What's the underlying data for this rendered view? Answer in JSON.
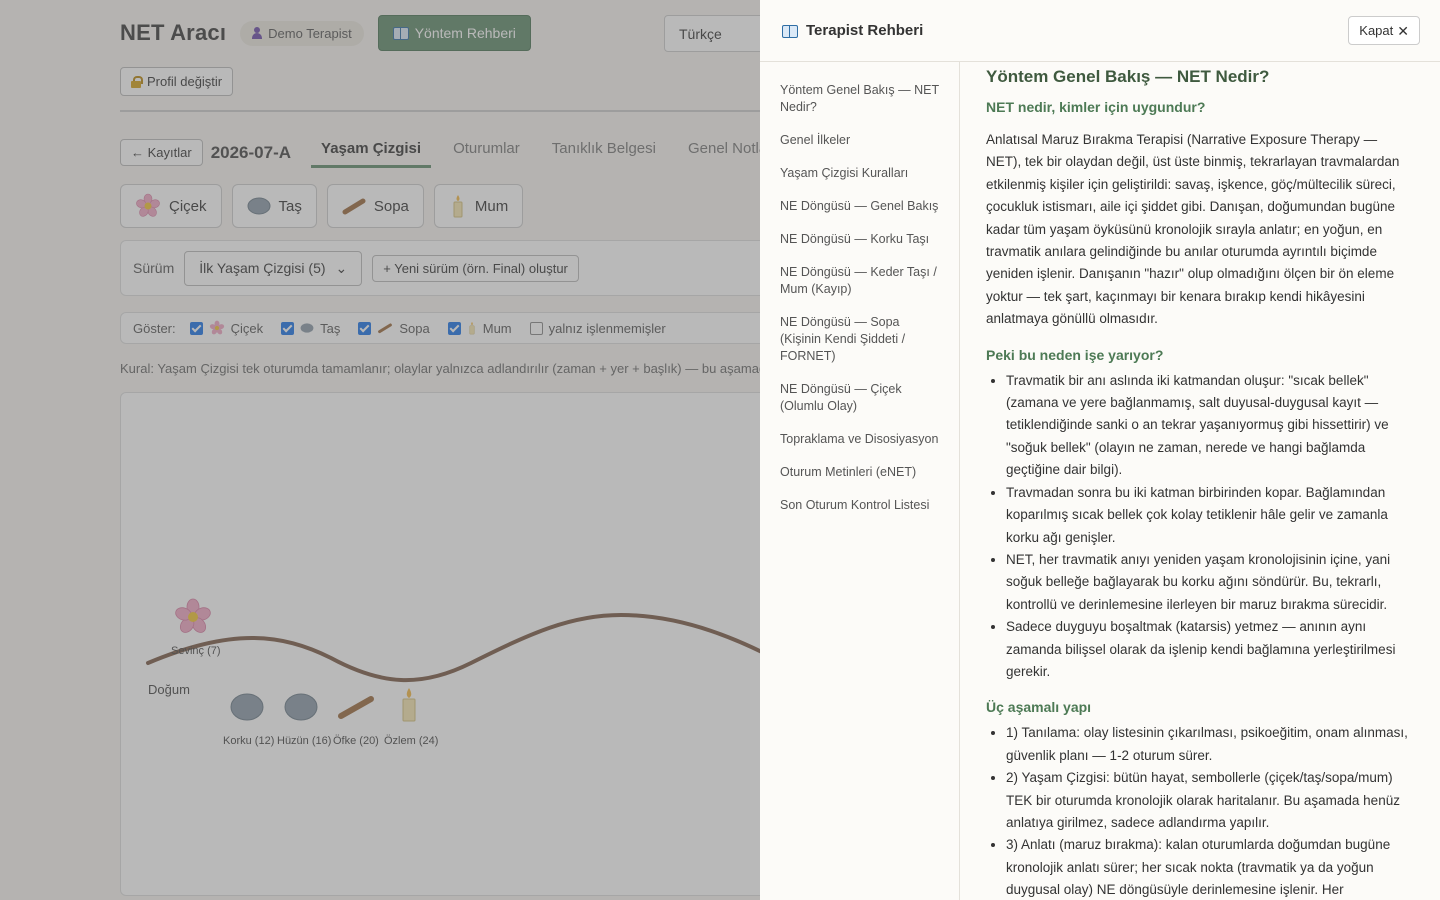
{
  "app": {
    "title": "NET Aracı",
    "user": "Demo Terapist",
    "guide_button": "Yöntem Rehberi",
    "language": "Türkçe",
    "profile_button": "Profil değiştir"
  },
  "record": {
    "back_label": "← Kayıtlar",
    "id": "2026-07-A",
    "tabs": [
      "Yaşam Çizgisi",
      "Oturumlar",
      "Tanıklık Belgesi",
      "Genel Notlar"
    ]
  },
  "symbols": {
    "flower": "Çiçek",
    "stone": "Taş",
    "stick": "Sopa",
    "candle": "Mum"
  },
  "version": {
    "label": "Sürüm",
    "selected": "İlk Yaşam Çizgisi (5)",
    "new_button": "+ Yeni sürüm (örn. Final) oluştur"
  },
  "filters": {
    "label": "Göster:",
    "flower": "Çiçek",
    "stone": "Taş",
    "stick": "Sopa",
    "candle": "Mum",
    "unprocessed": "yalnız işlenmemişler"
  },
  "rule": "Kural: Yaşam Çizgisi tek oturumda tamamlanır; olaylar yalnızca adlandırılır (zaman + yer + başlık) — bu aşamada anlatıya girilmez.",
  "timeline": {
    "birth": "Doğum",
    "events": [
      "Sevinç (7)",
      "Korku (12)",
      "Hüzün (16)",
      "Öfke (20)",
      "Özlem (24)"
    ]
  },
  "drawer": {
    "title": "Terapist Rehberi",
    "close": "Kapat",
    "nav": [
      "Yöntem Genel Bakış — NET Nedir?",
      "Genel İlkeler",
      "Yaşam Çizgisi Kuralları",
      "NE Döngüsü — Genel Bakış",
      "NE Döngüsü — Korku Taşı",
      "NE Döngüsü — Keder Taşı / Mum (Kayıp)",
      "NE Döngüsü — Sopa (Kişinin Kendi Şiddeti / FORNET)",
      "NE Döngüsü — Çiçek (Olumlu Olay)",
      "Topraklama ve Disosiyasyon",
      "Oturum Metinleri (eNET)",
      "Son Oturum Kontrol Listesi"
    ],
    "content": {
      "h2": "Yöntem Genel Bakış — NET Nedir?",
      "s1_title": "NET nedir, kimler için uygundur?",
      "s1_p": "Anlatısal Maruz Bırakma Terapisi (Narrative Exposure Therapy — NET), tek bir olaydan değil, üst üste binmiş, tekrarlayan travmalardan etkilenmiş kişiler için geliştirildi: savaş, işkence, göç/mültecilik süreci, çocukluk istismarı, aile içi şiddet gibi. Danışan, doğumundan bugüne kadar tüm yaşam öyküsünü kronolojik sırayla anlatır; en yoğun, en travmatik anılara gelindiğinde bu anılar oturumda ayrıntılı biçimde yeniden işlenir. Danışanın \"hazır\" olup olmadığını ölçen bir ön eleme yoktur — tek şart, kaçınmayı bir kenara bırakıp kendi hikâyesini anlatmaya gönüllü olmasıdır.",
      "s2_title": "Peki bu neden işe yarıyor?",
      "s2_items": [
        "Travmatik bir anı aslında iki katmandan oluşur: \"sıcak bellek\" (zamana ve yere bağlanmamış, salt duyusal-duygusal kayıt — tetiklendiğinde sanki o an tekrar yaşanıyormuş gibi hissettirir) ve \"soğuk bellek\" (olayın ne zaman, nerede ve hangi bağlamda geçtiğine dair bilgi).",
        "Travmadan sonra bu iki katman birbirinden kopar. Bağlamından koparılmış sıcak bellek çok kolay tetiklenir hâle gelir ve zamanla korku ağı genişler.",
        "NET, her travmatik anıyı yeniden yaşam kronolojisinin içine, yani soğuk belleğe bağlayarak bu korku ağını söndürür. Bu, tekrarlı, kontrollü ve derinlemesine ilerleyen bir maruz bırakma sürecidir.",
        "Sadece duyguyu boşaltmak (katarsis) yetmez — anının aynı zamanda bilişsel olarak da işlenip kendi bağlamına yerleştirilmesi gerekir."
      ],
      "s3_title": "Üç aşamalı yapı",
      "s3_items": [
        "1) Tanılama: olay listesinin çıkarılması, psikoeğitim, onam alınması, güvenlik planı — 1-2 oturum sürer.",
        "2) Yaşam Çizgisi: bütün hayat, sembollerle (çiçek/taş/sopa/mum) TEK bir oturumda kronolojik olarak haritalanır. Bu aşamada henüz anlatıya girilmez, sadece adlandırma yapılır.",
        "3) Anlatı (maruz bırakma): kalan oturumlarda doğumdan bugüne kronolojik anlatı sürer; her sıcak nokta (travmatik ya da yoğun duygusal olay) NE döngüsüyle derinlemesine işlenir. Her"
      ]
    }
  },
  "colors": {
    "accent_green": "#5f8a6a",
    "heading_green": "#4d7a55",
    "lifeline_brown": "#7a5a45"
  }
}
